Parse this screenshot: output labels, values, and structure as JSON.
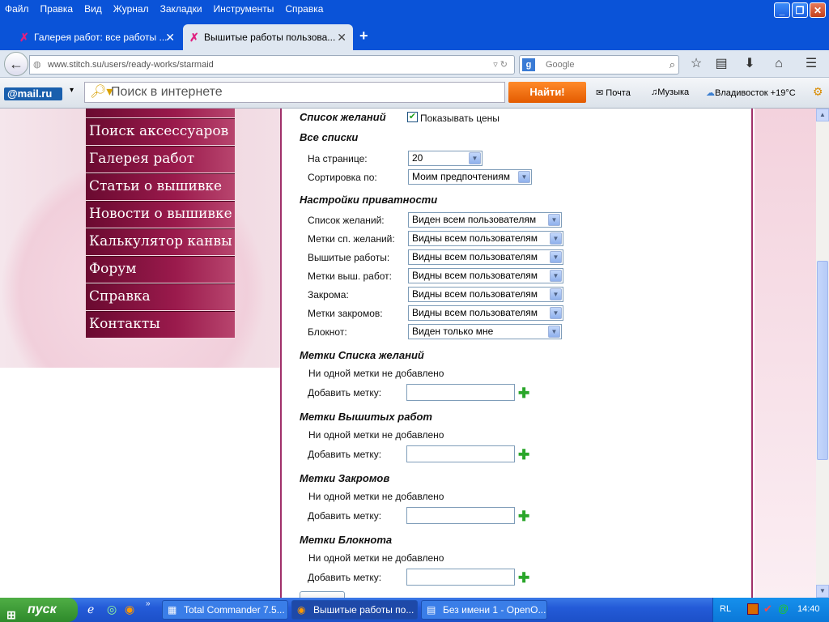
{
  "menubar": {
    "items": [
      "Файл",
      "Правка",
      "Вид",
      "Журнал",
      "Закладки",
      "Инструменты",
      "Справка"
    ]
  },
  "tabs": [
    {
      "title": "Галерея работ: все работы ...",
      "active": false
    },
    {
      "title": "Вышитые работы пользова...",
      "active": true
    }
  ],
  "nav": {
    "url": "www.stitch.su/users/ready-works/starmaid",
    "search_placeholder": "Google"
  },
  "mailbar": {
    "logo": "@mail.ru",
    "search_placeholder": "Поиск в интернете",
    "find_button": "Найти!",
    "mail": "Почта",
    "music": "Музыка",
    "weather": "Владивосток +19°C"
  },
  "sidemenu": {
    "items": [
      "Поиск аксессуаров",
      "Галерея работ",
      "Статьи о вышивке",
      "Новости о вышивке",
      "Калькулятор канвы",
      "Форум",
      "Справка",
      "Контакты"
    ]
  },
  "form": {
    "wishlist_title": "Список желаний",
    "show_prices": "Показывать цены",
    "all_lists_title": "Все списки",
    "per_page_label": "На странице:",
    "per_page_value": "20",
    "sort_label": "Сортировка по:",
    "sort_value": "Моим предпочтениям",
    "privacy_title": "Настройки приватности",
    "privacy": [
      {
        "label": "Список желаний:",
        "value": "Виден всем пользователям"
      },
      {
        "label": "Метки сп. желаний:",
        "value": "Видны всем пользователям"
      },
      {
        "label": "Вышитые работы:",
        "value": "Видны всем пользователям"
      },
      {
        "label": "Метки выш. работ:",
        "value": "Видны всем пользователям"
      },
      {
        "label": "Закрома:",
        "value": "Видны всем пользователям"
      },
      {
        "label": "Метки закромов:",
        "value": "Видны всем пользователям"
      },
      {
        "label": "Блокнот:",
        "value": "Виден только мне"
      }
    ],
    "tag_sections": [
      {
        "title": "Метки Списка желаний",
        "empty": "Ни одной метки не добавлено",
        "add_label": "Добавить метку:"
      },
      {
        "title": "Метки Вышитых работ",
        "empty": "Ни одной метки не добавлено",
        "add_label": "Добавить метку:"
      },
      {
        "title": "Метки Закромов",
        "empty": "Ни одной метки не добавлено",
        "add_label": "Добавить метку:"
      },
      {
        "title": "Метки Блокнота",
        "empty": "Ни одной метки не добавлено",
        "add_label": "Добавить метку:"
      }
    ]
  },
  "taskbar": {
    "start": "пуск",
    "buttons": [
      "Total Commander 7.5...",
      "Вышитые работы по...",
      "Без имени 1 - OpenO..."
    ],
    "lang": "RL",
    "clock": "14:40"
  }
}
